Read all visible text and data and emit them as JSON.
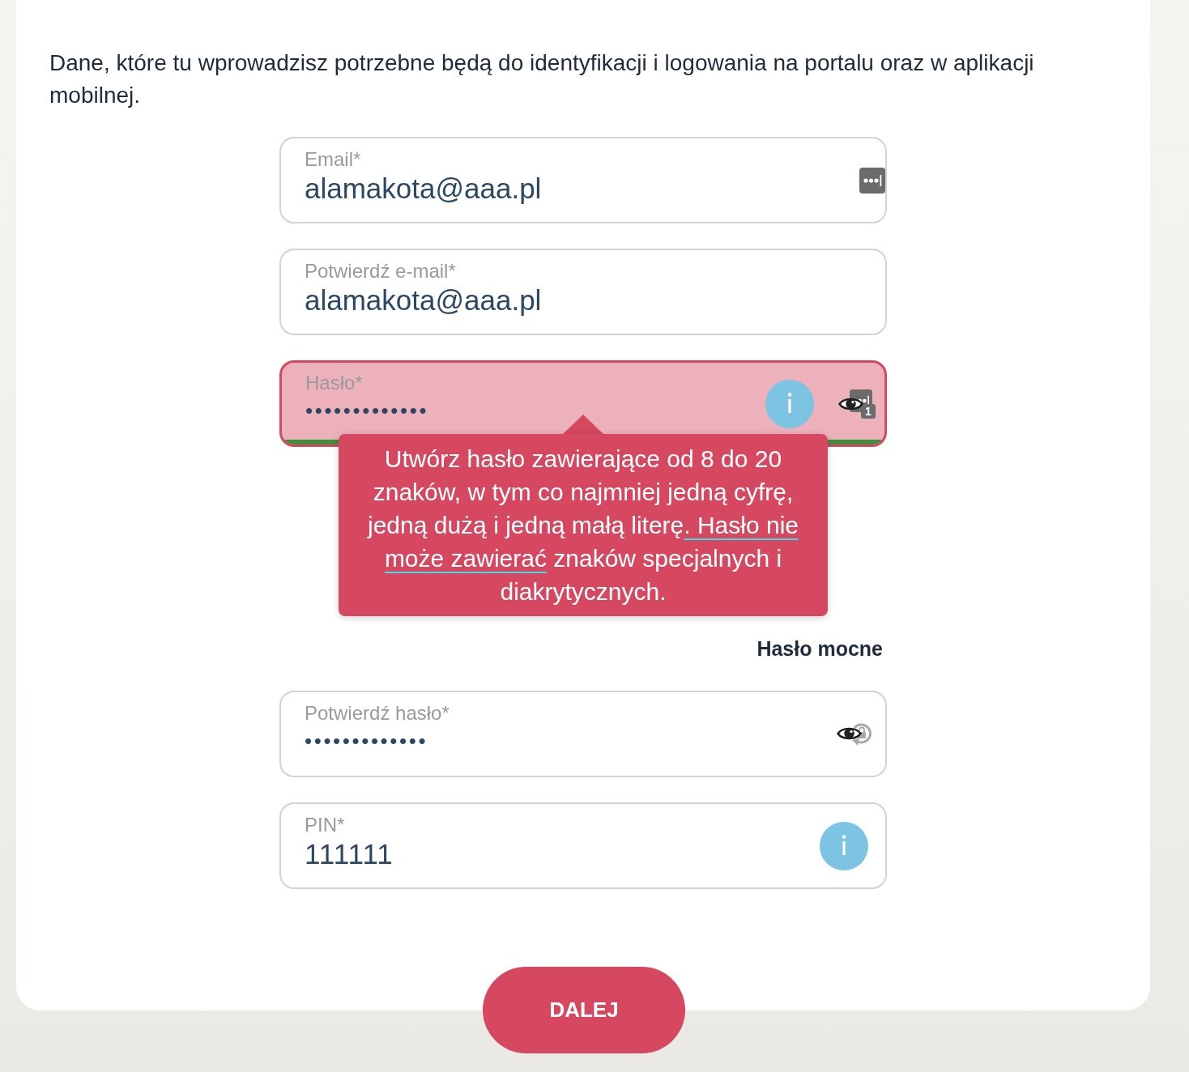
{
  "intro": {
    "text": "Dane, które tu wprowadzisz potrzebne będą do identyfikacji i logowania na portalu oraz w aplikacji mobilnej."
  },
  "fields": [
    {
      "kind": "email",
      "label": "Email*",
      "value": "alamakota@aaa.pl",
      "active": false
    },
    {
      "kind": "email_confirm",
      "label": "Potwierdź e-mail*",
      "value": "alamakota@aaa.pl",
      "active": false
    },
    {
      "kind": "password",
      "label": "Hasło*",
      "value": "•••••••••••••",
      "active": true,
      "badge": "1",
      "tooltip": {
        "segments": [
          {
            "text": "Utwórz hasło zawierające od 8 do 20 znaków, w tym co najmniej jedną cyfrę, jedną dużą i jedną małą literę",
            "underlined": false
          },
          {
            "text": ". Hasło nie może zawierać",
            "underlined": true
          },
          {
            "text": " znaków specjalnych i diakrytycznych.",
            "underlined": false
          }
        ]
      },
      "strength": {
        "level": 1,
        "label": "Hasło mocne"
      }
    },
    {
      "kind": "password_confirm",
      "label": "Potwierdź hasło*",
      "value": "•••••••••••••",
      "active": false
    },
    {
      "kind": "pin",
      "label": "PIN*",
      "value": "111111",
      "active": false
    }
  ],
  "button": {
    "label": "DALEJ"
  }
}
